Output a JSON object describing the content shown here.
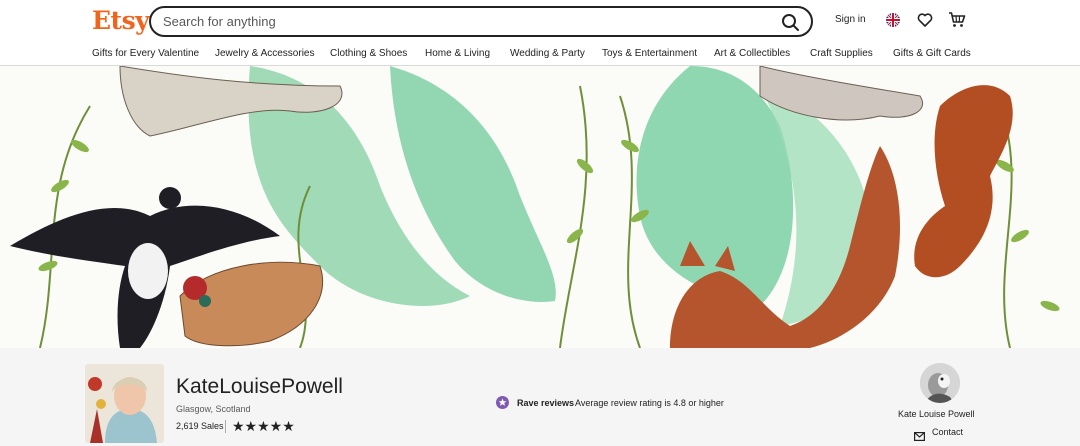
{
  "brand": {
    "logo_text": "Etsy",
    "accent_color": "#F1641E"
  },
  "search": {
    "placeholder": "Search for anything",
    "icon": "search-icon"
  },
  "header": {
    "signin_label": "Sign in",
    "icons": [
      "language-flag-icon",
      "heart-icon",
      "cart-icon"
    ]
  },
  "categories": [
    "Gifts for Every Valentine",
    "Jewelry & Accessories",
    "Clothing & Shoes",
    "Home & Living",
    "Wedding & Party",
    "Toys & Entertainment",
    "Art & Collectibles",
    "Craft Supplies",
    "Gifts & Gift Cards"
  ],
  "shop": {
    "name": "KateLouisePowell",
    "location": "Glasgow, Scotland",
    "sales": "2,619 Sales",
    "stars": "★★★★★",
    "rating_stars": 5
  },
  "reviews": {
    "badge_title": "Rave reviews",
    "badge_text": "Average review rating is 4.8 or higher",
    "badge_color": "#7F5AB2"
  },
  "owner": {
    "name": "Kate Louise Powell",
    "contact_label": "Contact"
  }
}
